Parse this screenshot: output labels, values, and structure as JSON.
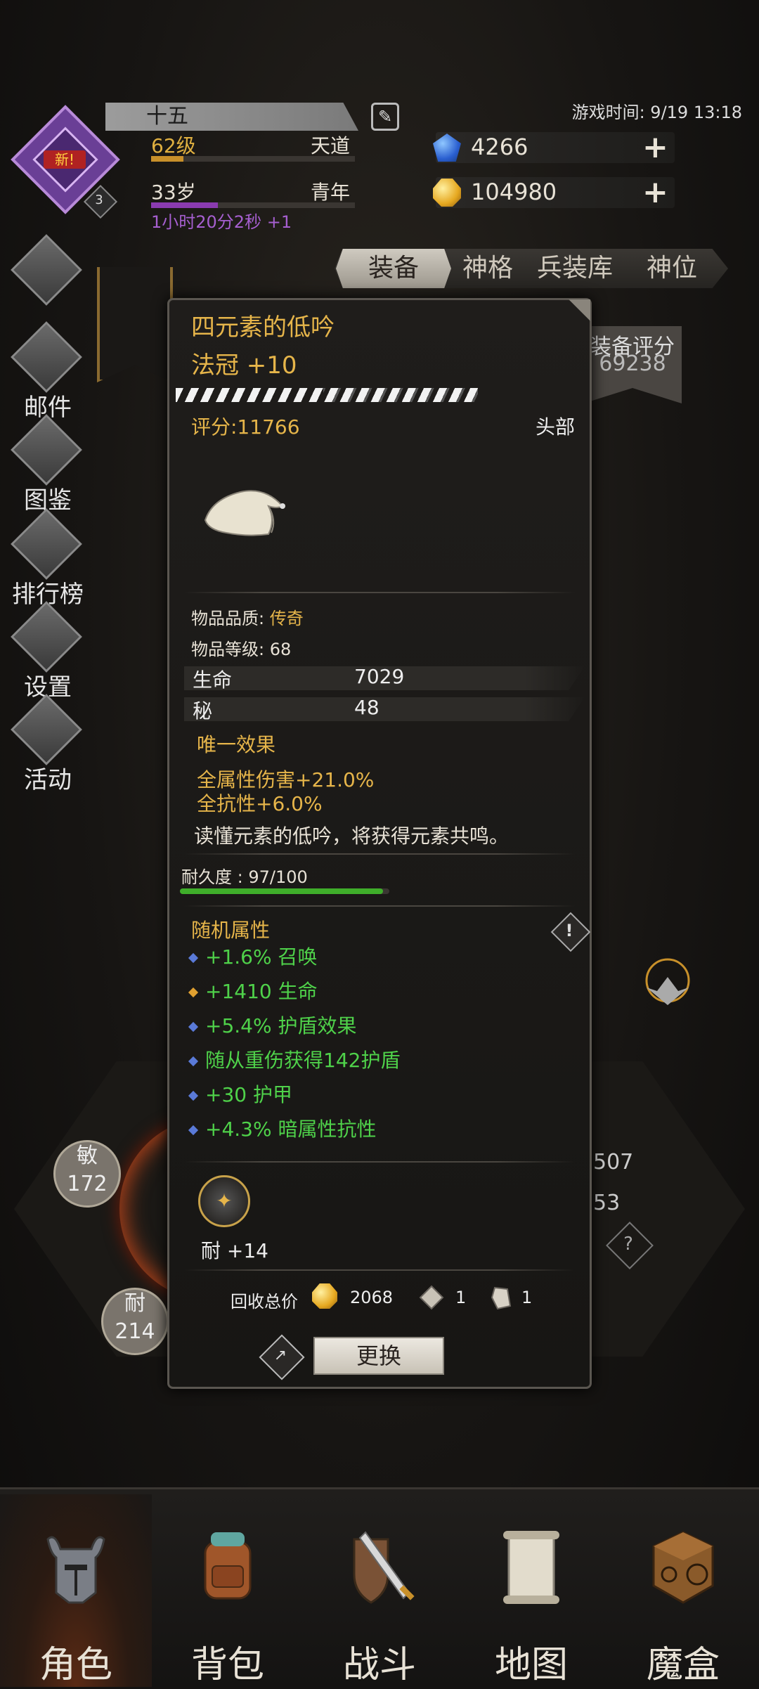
{
  "header": {
    "name": "十五",
    "level": "62级",
    "realm": "天道",
    "age": "33岁",
    "stage": "青年",
    "timer": "1小时20分2秒 +1",
    "game_time": "游戏时间: 9/19 13:18",
    "avatar_badge": "新!",
    "avatar_count": "3",
    "currency_blue": "4266",
    "currency_gold": "104980"
  },
  "left_menu": {
    "mail": "邮件",
    "codex": "图鉴",
    "ranking": "排行榜",
    "settings": "设置",
    "events": "活动"
  },
  "tabs": [
    "装备",
    "神格",
    "兵装库",
    "神位"
  ],
  "equip_score": {
    "label": "装备评分",
    "value": "69238"
  },
  "radar": {
    "agi_label": "敏",
    "agi_value": "172",
    "end_label": "耐",
    "end_value": "214",
    "right_value_1": "507",
    "right_value_2": "53"
  },
  "item": {
    "name": "四元素的低吟",
    "type": "法冠 +10",
    "enhance_progress": 0.5,
    "rating": "评分:11766",
    "slot": "头部",
    "quality_label": "物品品质: ",
    "quality_value": "传奇",
    "item_level": "物品等级: 68",
    "stats": [
      {
        "name": "生命",
        "value": "7029"
      },
      {
        "name": "秘",
        "value": "48"
      }
    ],
    "unique_title": "唯一效果",
    "unique_lines": [
      "全属性伤害+21.0%",
      "全抗性+6.0%"
    ],
    "description": "读懂元素的低吟，将获得元素共鸣。",
    "durability": "耐久度 : 97/100",
    "durability_fraction": 0.97,
    "random_title": "随机属性",
    "random_attrs": [
      {
        "text": "+1.6% 召唤",
        "bullet": "#5a7ad8"
      },
      {
        "text": "+1410 生命",
        "bullet": "#e0a030"
      },
      {
        "text": "+5.4% 护盾效果",
        "bullet": "#5a7ad8"
      },
      {
        "text": "随从重伤获得142护盾",
        "bullet": "#5a7ad8"
      },
      {
        "text": "+30 护甲",
        "bullet": "#5a7ad8"
      },
      {
        "text": "+4.3% 暗属性抗性",
        "bullet": "#5a7ad8"
      }
    ],
    "rune_label": "耐 +14",
    "recycle_label": "回收总价",
    "recycle_gold": "2068",
    "recycle_mat1": "1",
    "recycle_mat2": "1",
    "replace_button": "更换"
  },
  "bottom_nav": [
    "角色",
    "背包",
    "战斗",
    "地图",
    "魔盒"
  ],
  "colors": {
    "accent_gold": "#e6b54a",
    "attr_green": "#4fd24a",
    "age_purple": "#a65fd0"
  }
}
